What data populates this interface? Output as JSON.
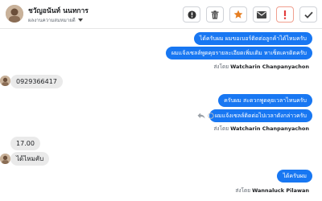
{
  "header": {
    "contact_name": "ชวัญอนันท์ นนทการ",
    "contact_subtitle": "ผลงานความสมหมายดี"
  },
  "toolbar": {
    "buttons": [
      {
        "icon": "info-icon"
      },
      {
        "icon": "trash-icon"
      },
      {
        "icon": "star-icon"
      },
      {
        "icon": "mail-icon"
      },
      {
        "icon": "exclamation-icon",
        "color": "#e23d3d"
      },
      {
        "icon": "checkmark-icon"
      }
    ]
  },
  "messages": {
    "out_1": "ได้ครับผม ผมขอเบอร์ติดต่อลูกค้าได้ไหมครับ",
    "out_2": "ผมแจ้งเซลล์พูดคุยรายละเอียดเพิ่มเติม หาเซ็ตเครดิตครับ",
    "sent_by_1_prefix": "ส่งโดย",
    "sent_by_1_name": "Watcharin Chanpanyachon",
    "in_1": "0929366417",
    "out_3": "ครับผม สะดวกพูดคุยเวลาไหนครับ",
    "out_4": "ผมแจ้งเซลล์ติดต่อไปเวลาดังกล่าวครับ",
    "sent_by_2_prefix": "ส่งโดย",
    "sent_by_2_name": "Watcharin Chanpanyachon",
    "in_2": "17.00",
    "in_3": "ได้ไหมคับ",
    "out_5": "ได้ครับผม",
    "sent_by_3_prefix": "ส่งโดย",
    "sent_by_3_name": "Wannaluck Pilawan"
  },
  "colors": {
    "bubble_out": "#1877f2",
    "bubble_in": "#eaeaea",
    "alert": "#e23d3d",
    "star": "#e67e22"
  }
}
